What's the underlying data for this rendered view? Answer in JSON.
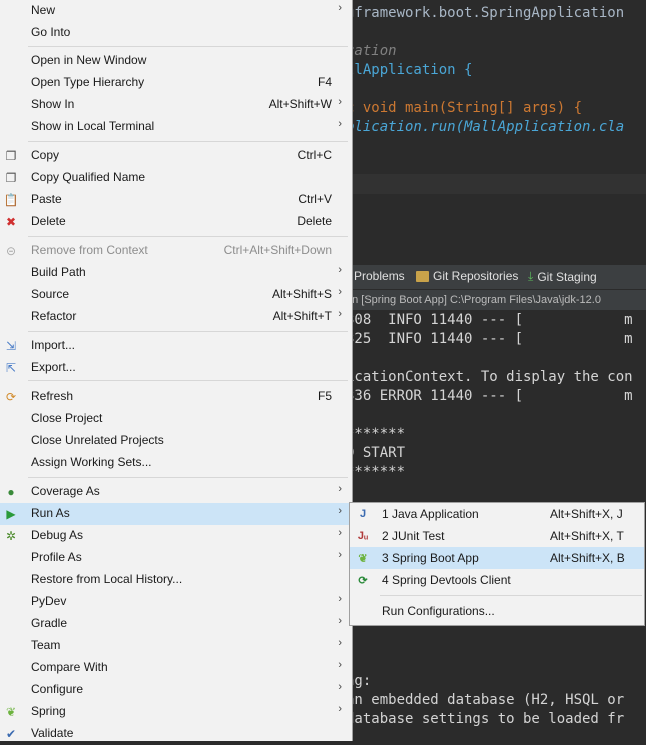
{
  "editor": {
    "lines": [
      {
        "text": "gframework.boot.SpringApplication",
        "color": "#a9b7c6"
      },
      {
        "text": "cation",
        "color": "#808080"
      },
      {
        "text": "llApplication {",
        "color": "#4aa6d6"
      },
      {
        "text": "c void main(String[] args) {",
        "color": "#cc7832"
      },
      {
        "text": "plication.run(MallApplication.cla",
        "color": "#4aa6d6"
      }
    ]
  },
  "panel": {
    "tabs": [
      "Problems",
      "Git Repositories",
      "Git Staging"
    ],
    "console_path": "on [Spring Boot App] C:\\Program Files\\Java\\jdk-12.0",
    "console_lines": [
      "308  INFO 11440 --- [            m",
      "325  INFO 11440 --- [            m",
      "",
      "icationContext. To display the con",
      "336 ERROR 11440 --- [            m",
      "",
      "*******",
      "D START",
      "*******",
      "",
      "",
      "",
      "",
      "",
      "",
      "",
      "",
      "",
      "",
      "ng:",
      "an embedded database (H2, HSQL or",
      "database settings to be loaded fr"
    ]
  },
  "menu": {
    "items": [
      {
        "label": "New",
        "accel": "",
        "sub": true
      },
      {
        "label": "Go Into",
        "accel": "",
        "sub": false
      },
      {
        "label": "Open in New Window",
        "accel": "",
        "sub": false
      },
      {
        "label": "Open Type Hierarchy",
        "accel": "F4",
        "sub": false
      },
      {
        "label": "Show In",
        "accel": "Alt+Shift+W",
        "sub": true
      },
      {
        "label": "Show in Local Terminal",
        "accel": "",
        "sub": true
      },
      {
        "label": "Copy",
        "accel": "Ctrl+C",
        "sub": false
      },
      {
        "label": "Copy Qualified Name",
        "accel": "",
        "sub": false
      },
      {
        "label": "Paste",
        "accel": "Ctrl+V",
        "sub": false
      },
      {
        "label": "Delete",
        "accel": "Delete",
        "sub": false
      },
      {
        "label": "Remove from Context",
        "accel": "Ctrl+Alt+Shift+Down",
        "sub": false
      },
      {
        "label": "Build Path",
        "accel": "",
        "sub": true
      },
      {
        "label": "Source",
        "accel": "Alt+Shift+S",
        "sub": true
      },
      {
        "label": "Refactor",
        "accel": "Alt+Shift+T",
        "sub": true
      },
      {
        "label": "Import...",
        "accel": "",
        "sub": false
      },
      {
        "label": "Export...",
        "accel": "",
        "sub": false
      },
      {
        "label": "Refresh",
        "accel": "F5",
        "sub": false
      },
      {
        "label": "Close Project",
        "accel": "",
        "sub": false
      },
      {
        "label": "Close Unrelated Projects",
        "accel": "",
        "sub": false
      },
      {
        "label": "Assign Working Sets...",
        "accel": "",
        "sub": false
      },
      {
        "label": "Coverage As",
        "accel": "",
        "sub": true
      },
      {
        "label": "Run As",
        "accel": "",
        "sub": true
      },
      {
        "label": "Debug As",
        "accel": "",
        "sub": true
      },
      {
        "label": "Profile As",
        "accel": "",
        "sub": true
      },
      {
        "label": "Restore from Local History...",
        "accel": "",
        "sub": false
      },
      {
        "label": "PyDev",
        "accel": "",
        "sub": true
      },
      {
        "label": "Gradle",
        "accel": "",
        "sub": true
      },
      {
        "label": "Team",
        "accel": "",
        "sub": true
      },
      {
        "label": "Compare With",
        "accel": "",
        "sub": true
      },
      {
        "label": "Configure",
        "accel": "",
        "sub": true
      },
      {
        "label": "Spring",
        "accel": "",
        "sub": true
      },
      {
        "label": "Validate",
        "accel": "",
        "sub": false
      }
    ]
  },
  "submenu": {
    "items": [
      {
        "label": "1 Java Application",
        "accel": "Alt+Shift+X, J"
      },
      {
        "label": "2 JUnit Test",
        "accel": "Alt+Shift+X, T"
      },
      {
        "label": "3 Spring Boot App",
        "accel": "Alt+Shift+X, B"
      },
      {
        "label": "4 Spring Devtools Client",
        "accel": ""
      },
      {
        "label": "Run Configurations...",
        "accel": ""
      }
    ]
  }
}
